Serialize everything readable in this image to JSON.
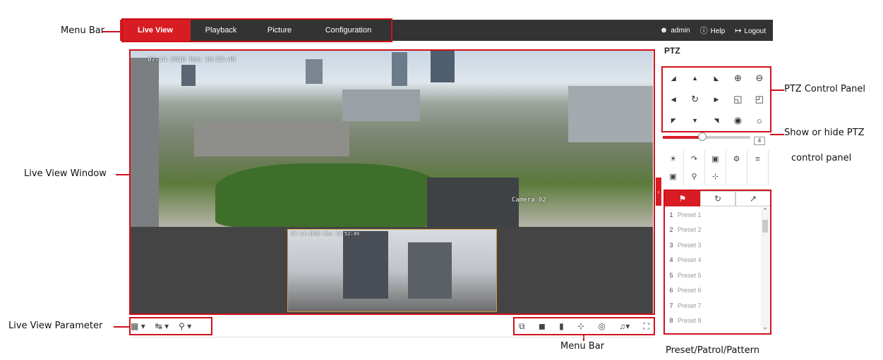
{
  "callouts": {
    "menu_bar_top": "Menu Bar",
    "live_view_window": "Live View Window",
    "live_view_parameter": "Live View Parameter",
    "menu_bar_bottom": "Menu Bar",
    "ptz_control_panel": "PTZ Control Panel",
    "show_hide_line1": "Show or hide PTZ",
    "show_hide_line2": "control panel",
    "preset_patrol_pattern": "Preset/Patrol/Pattern"
  },
  "menu": {
    "tabs": [
      {
        "label": "Live View",
        "active": true
      },
      {
        "label": "Playback",
        "active": false
      },
      {
        "label": "Picture",
        "active": false
      },
      {
        "label": "Configuration",
        "active": false
      }
    ],
    "user": "admin",
    "help": "Help",
    "logout": "Logout"
  },
  "live_view": {
    "osd_time": "07-14-2010 Mon 10:52:49",
    "camera_label": "Camera 02",
    "pip_time": "07-14-2010 Mon 10:52:49"
  },
  "ptz": {
    "title": "PTZ",
    "speed_value": "4",
    "speed_level": 0.45
  },
  "presets": [
    {
      "num": "1",
      "name": "Preset 1"
    },
    {
      "num": "2",
      "name": "Preset 2"
    },
    {
      "num": "3",
      "name": "Preset 3"
    },
    {
      "num": "4",
      "name": "Preset 4"
    },
    {
      "num": "5",
      "name": "Preset 5"
    },
    {
      "num": "6",
      "name": "Preset 6"
    },
    {
      "num": "7",
      "name": "Preset 7"
    },
    {
      "num": "8",
      "name": "Preset 8"
    }
  ],
  "colors": {
    "accent": "#d71c24",
    "callout_red": "#d0111b",
    "menubar": "#333333"
  }
}
